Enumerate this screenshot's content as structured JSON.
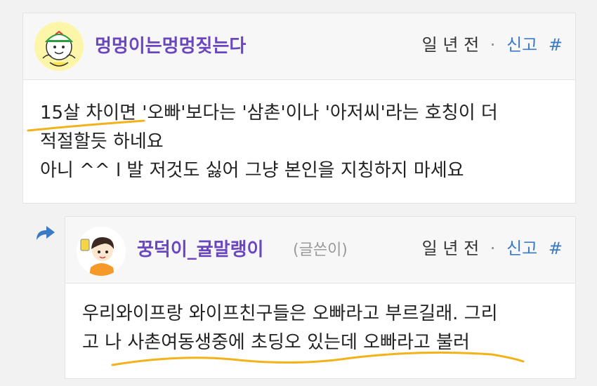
{
  "comments": [
    {
      "username": "멍멍이는멍멍짖는다",
      "time": "일 년 전",
      "separator": "·",
      "report_label": "신고",
      "hash_label": "#",
      "lines": [
        "15살 차이면 '오빠'보다는 '삼촌'이나 '아저씨'라는 호칭이 더",
        "적절할듯 하네요",
        "아니 ^^ l 발 저것도 싫어 그냥 본인을 지칭하지 마세요"
      ]
    },
    {
      "username": "꿍덕이_귤말랭이",
      "author_tag": "(글쓴이)",
      "time": "일 년 전",
      "separator": "·",
      "report_label": "신고",
      "hash_label": "#",
      "lines": [
        "우리와이프랑 와이프친구들은 오빠라고 부르길래. 그리",
        "고 나 사촌여동생중에 초딩오 있는데 오빠라고 불러"
      ]
    }
  ],
  "icons": {
    "reply": "reply-arrow-icon"
  },
  "colors": {
    "username": "#6b46c1",
    "link": "#3b7bc6",
    "highlight_underline": "#f2b21a"
  }
}
